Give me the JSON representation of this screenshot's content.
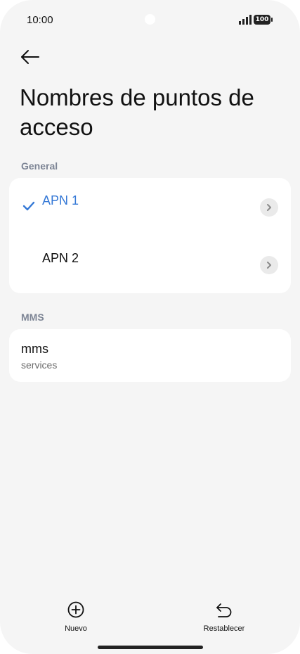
{
  "status_bar": {
    "time": "10:00",
    "battery": "100",
    "icons": [
      "signal-icon",
      "battery-icon"
    ]
  },
  "header": {
    "back_icon": "back-arrow-icon",
    "title": "Nombres de puntos de acceso"
  },
  "sections": {
    "general": {
      "label": "General",
      "items": [
        {
          "label": "APN 1",
          "selected": true
        },
        {
          "label": "APN 2",
          "selected": false
        }
      ]
    },
    "mms": {
      "label": "MMS",
      "item": {
        "title": "mms",
        "subtitle": "services"
      }
    }
  },
  "bottom_bar": {
    "new_label": "Nuevo",
    "reset_label": "Restablecer"
  },
  "colors": {
    "accent": "#3478d6",
    "background": "#f5f5f5",
    "card": "#ffffff",
    "section_label": "#7d8595"
  }
}
